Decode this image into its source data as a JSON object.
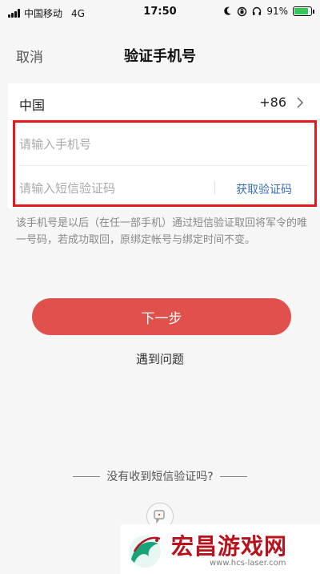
{
  "status_bar": {
    "carrier": "中国移动",
    "network": "4G",
    "time": "17:50",
    "battery_percent": "91%",
    "battery_level": 0.91,
    "icons": [
      "signal-icon",
      "moon-icon",
      "lock-rotation-icon",
      "headphones-icon",
      "battery-icon"
    ]
  },
  "nav": {
    "cancel_label": "取消",
    "title": "验证手机号"
  },
  "country": {
    "name": "中国",
    "code": "+86"
  },
  "form": {
    "phone_placeholder": "请输入手机号",
    "code_placeholder": "请输入短信验证码",
    "get_code_label": "获取验证码"
  },
  "notice": "该手机号是以后（在任一部手机）通过短信验证取回将军令的唯一号码，若成功取回，原绑定帐号与绑定时间不变。",
  "actions": {
    "next_label": "下一步",
    "problem_label": "遇到问题"
  },
  "no_sms": {
    "label": "没有收到短信验证吗?"
  },
  "watermark": {
    "brand": "宏昌游戏网",
    "url": "www.hcs-laser.com"
  },
  "colors": {
    "accent": "#e0514d",
    "link": "#3a6fb0",
    "highlight": "#e51a1a",
    "brand": "#b8121c",
    "background": "#f6f6f6"
  }
}
